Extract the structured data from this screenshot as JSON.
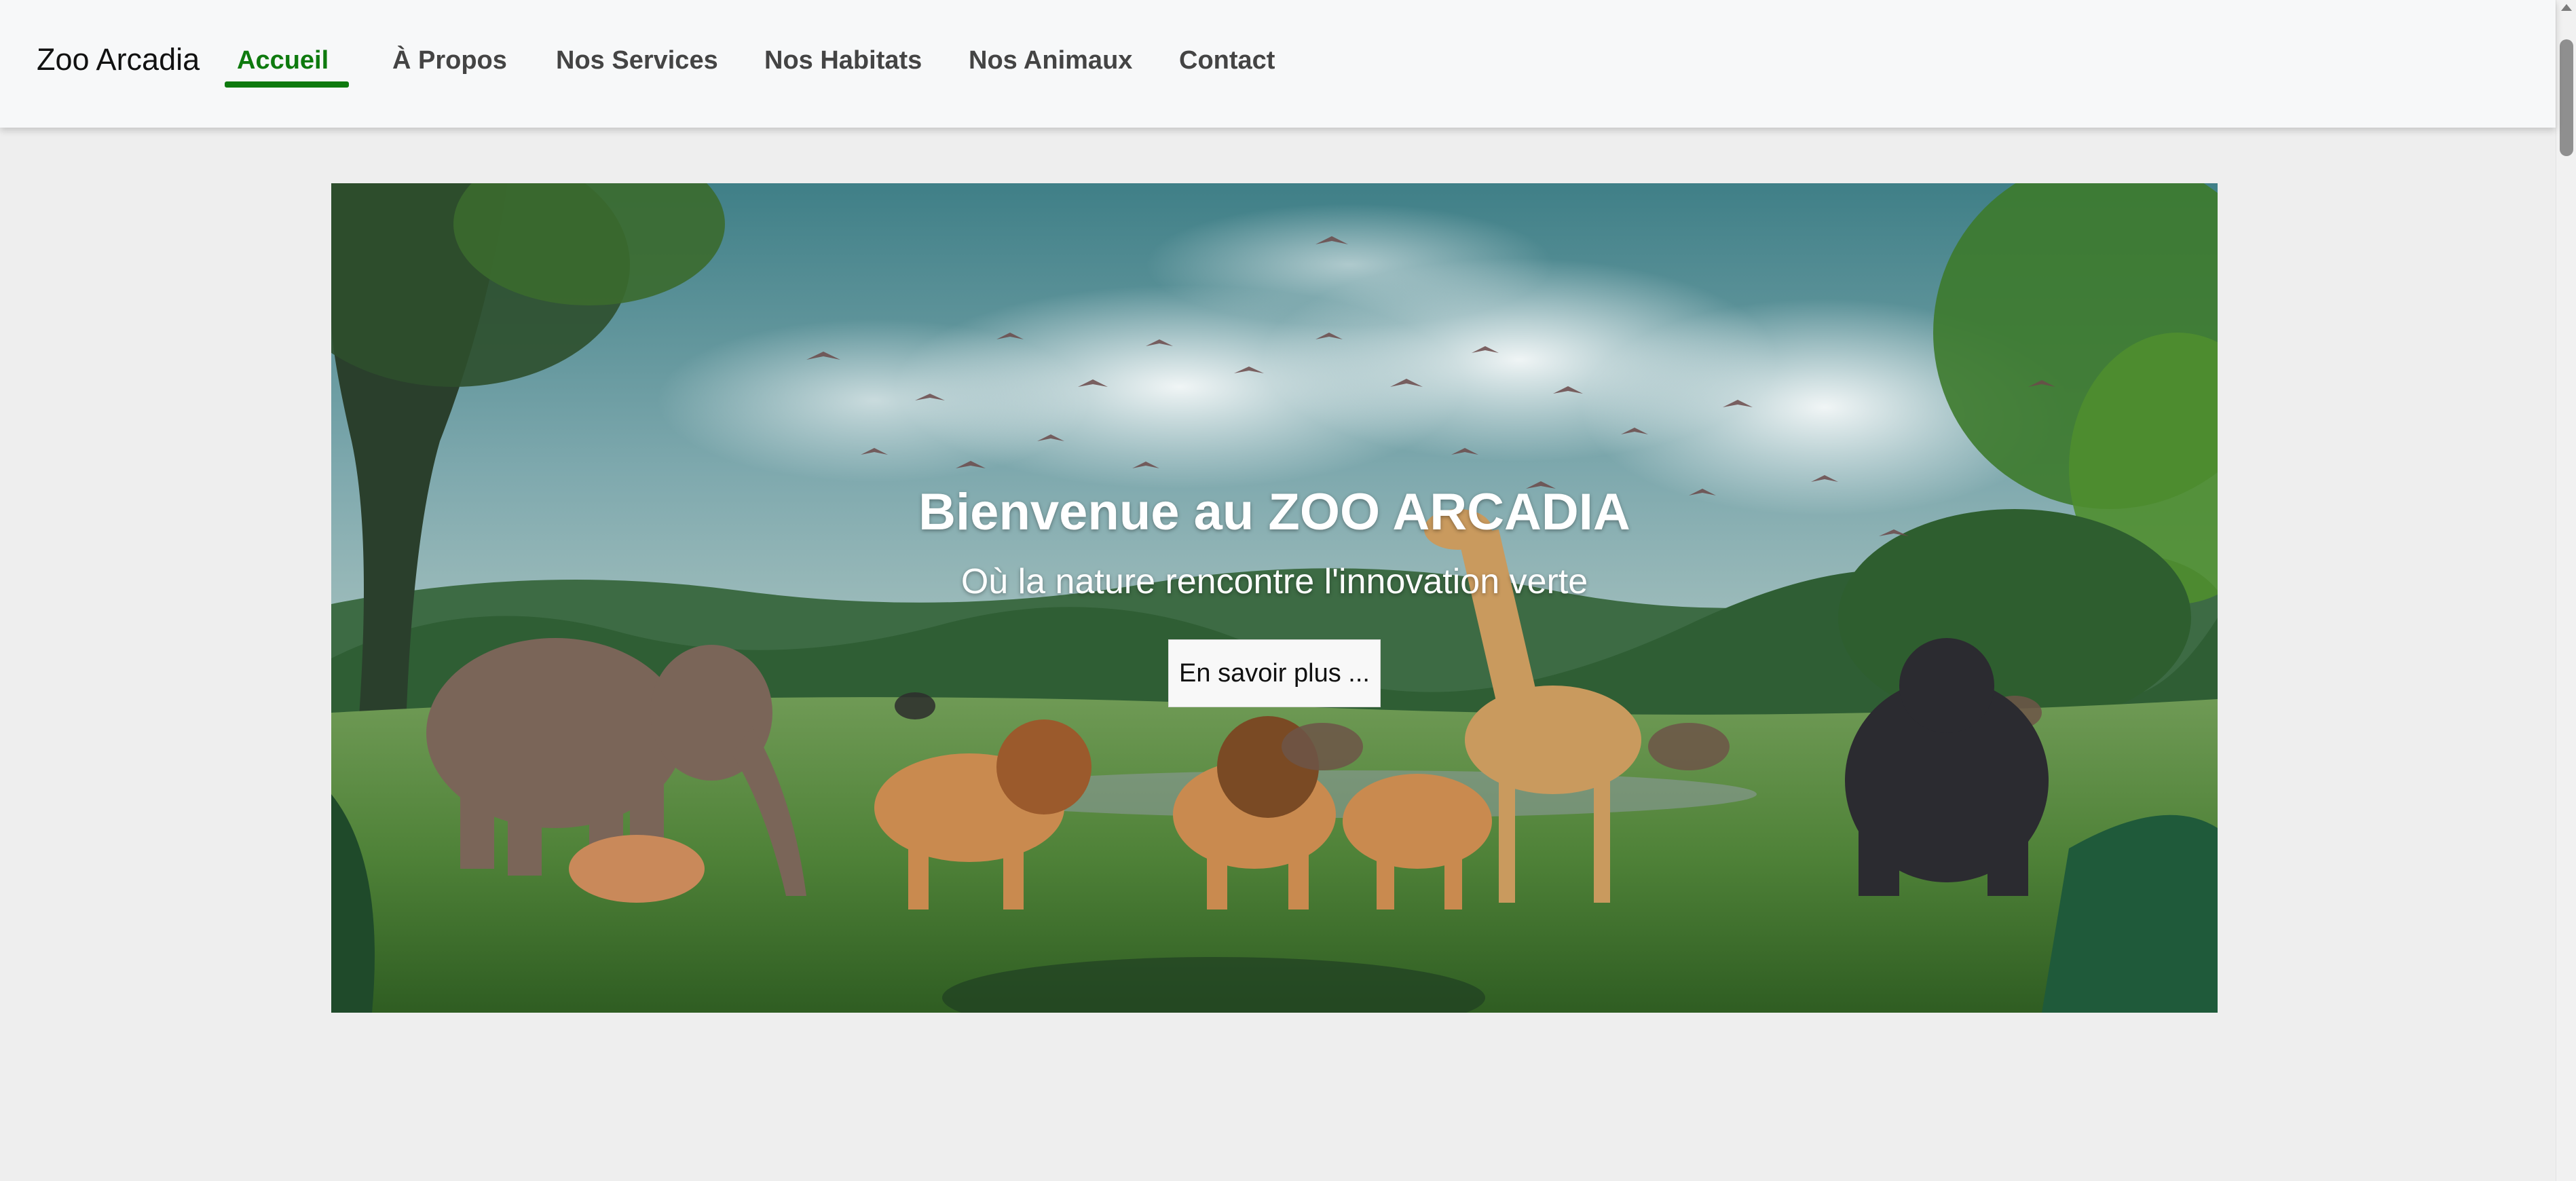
{
  "navbar": {
    "brand": "Zoo Arcadia",
    "links": [
      {
        "label": "Accueil",
        "active": true
      },
      {
        "label": "À Propos",
        "active": false
      },
      {
        "label": "Nos Services",
        "active": false
      },
      {
        "label": "Nos Habitats",
        "active": false
      },
      {
        "label": "Nos Animaux",
        "active": false
      },
      {
        "label": "Contact",
        "active": false
      }
    ]
  },
  "hero": {
    "title": "Bienvenue au ZOO ARCADIA",
    "subtitle": "Où la nature rencontre l'innovation verte",
    "button_label": "En savoir plus ..."
  },
  "colors": {
    "accent": "#0e7a0e",
    "page_background": "#eeeeee",
    "navbar_background": "#f7f8f9"
  }
}
